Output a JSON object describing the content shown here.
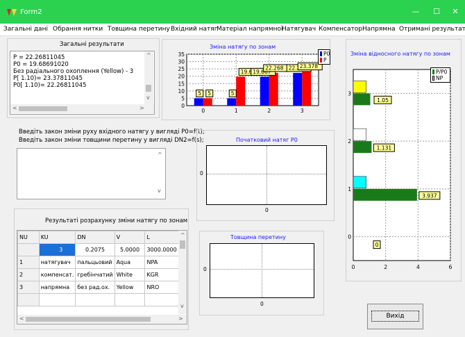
{
  "window": {
    "title": "Form2",
    "min": "—",
    "max": "☐",
    "close": "✕"
  },
  "menu": [
    "Загальні дані",
    "Обрання нитки",
    "Товщина перетину",
    "Вхідний натяг",
    "Матеріал напрямної",
    "Натягувач",
    "Компенсатор",
    "Напрямна",
    "Отримані результати"
  ],
  "results": {
    "title": "Загальні результати",
    "lines": [
      "P =    22.26811045",
      "P0 =     19.68691020",
      "Без радіального охоплення (Yellow) -  3",
      "P[ 1.10)=     23.37811045",
      "P0[ 1.10)=     22.26811045"
    ]
  },
  "inputs": {
    "line1": "Введіть закон зміни руху вхідного натягу у вигляді P0=f(t);",
    "line2": "Введіть закон зміни товщини перетину у вигляді DN2=f(s);"
  },
  "table": {
    "title": "Результаті розрахунку зміни натягу по зонам",
    "headers": [
      "NU",
      "KU",
      "DN",
      "V",
      "L"
    ],
    "rows": [
      [
        "",
        "3",
        "0.2075",
        "5.0000",
        "3000.0000"
      ],
      [
        "1",
        "натягувач",
        "пальцьовий",
        "Aqua",
        "NPA"
      ],
      [
        "2",
        "компенсат.",
        "гребінчатий",
        "White",
        "KGR"
      ],
      [
        "3",
        "напрямна",
        "без рад.ох.",
        "Yellow",
        "NRO"
      ],
      [
        "",
        "",
        "",
        "",
        ""
      ],
      [
        "",
        "",
        "",
        "",
        ""
      ]
    ]
  },
  "exit_label": "Вихід",
  "colors": {
    "p0": "#0000ff",
    "p": "#ff0000",
    "green": "#1a7a1a",
    "yellow": "#ffff00",
    "aqua": "#00ffff",
    "white": "#ffffff",
    "title_bar": "#2bd24f"
  },
  "chart_data": [
    {
      "type": "bar",
      "title": "Зміна натягу по зонам",
      "categories": [
        "0",
        "1",
        "2",
        "3"
      ],
      "series": [
        {
          "name": "P0",
          "values": [
            5,
            5,
            19.687,
            22.268
          ]
        },
        {
          "name": "P",
          "values": [
            5,
            19.687,
            22.268,
            23.378
          ]
        }
      ],
      "data_labels": [
        "5",
        "5",
        "5",
        "19.687",
        "19.687",
        "22.268",
        "22.268",
        "23.378"
      ],
      "yticks": [
        "0",
        "5",
        "10",
        "15",
        "20",
        "25",
        "30",
        "35"
      ],
      "ylim": [
        0,
        35
      ]
    },
    {
      "type": "bar",
      "title": "Зміна відносного натягу по зонам",
      "orientation": "horizontal",
      "categories": [
        "0",
        "1",
        "2",
        "3"
      ],
      "series": [
        {
          "name": "P/P0",
          "values": [
            0,
            3.937,
            1.131,
            1.05
          ]
        },
        {
          "name": "NP",
          "values": [
            0,
            0.8,
            0.8,
            0.8
          ]
        }
      ],
      "np_colors": [
        "#ffffff",
        "#00ffff",
        "#ffffff",
        "#ffff00"
      ],
      "data_labels": [
        "0",
        "3.937",
        "1.131",
        "1.05"
      ],
      "xticks": [
        "0",
        "2",
        "4",
        "6"
      ],
      "xlim": [
        0,
        6
      ]
    },
    {
      "type": "line",
      "title": "Початковий натяг P0",
      "series": [],
      "xticks": [
        "0"
      ],
      "yticks": [
        "0"
      ]
    },
    {
      "type": "line",
      "title": "Товщина перетину",
      "series": [],
      "xticks": [
        "0"
      ],
      "yticks": [
        "0"
      ]
    }
  ]
}
